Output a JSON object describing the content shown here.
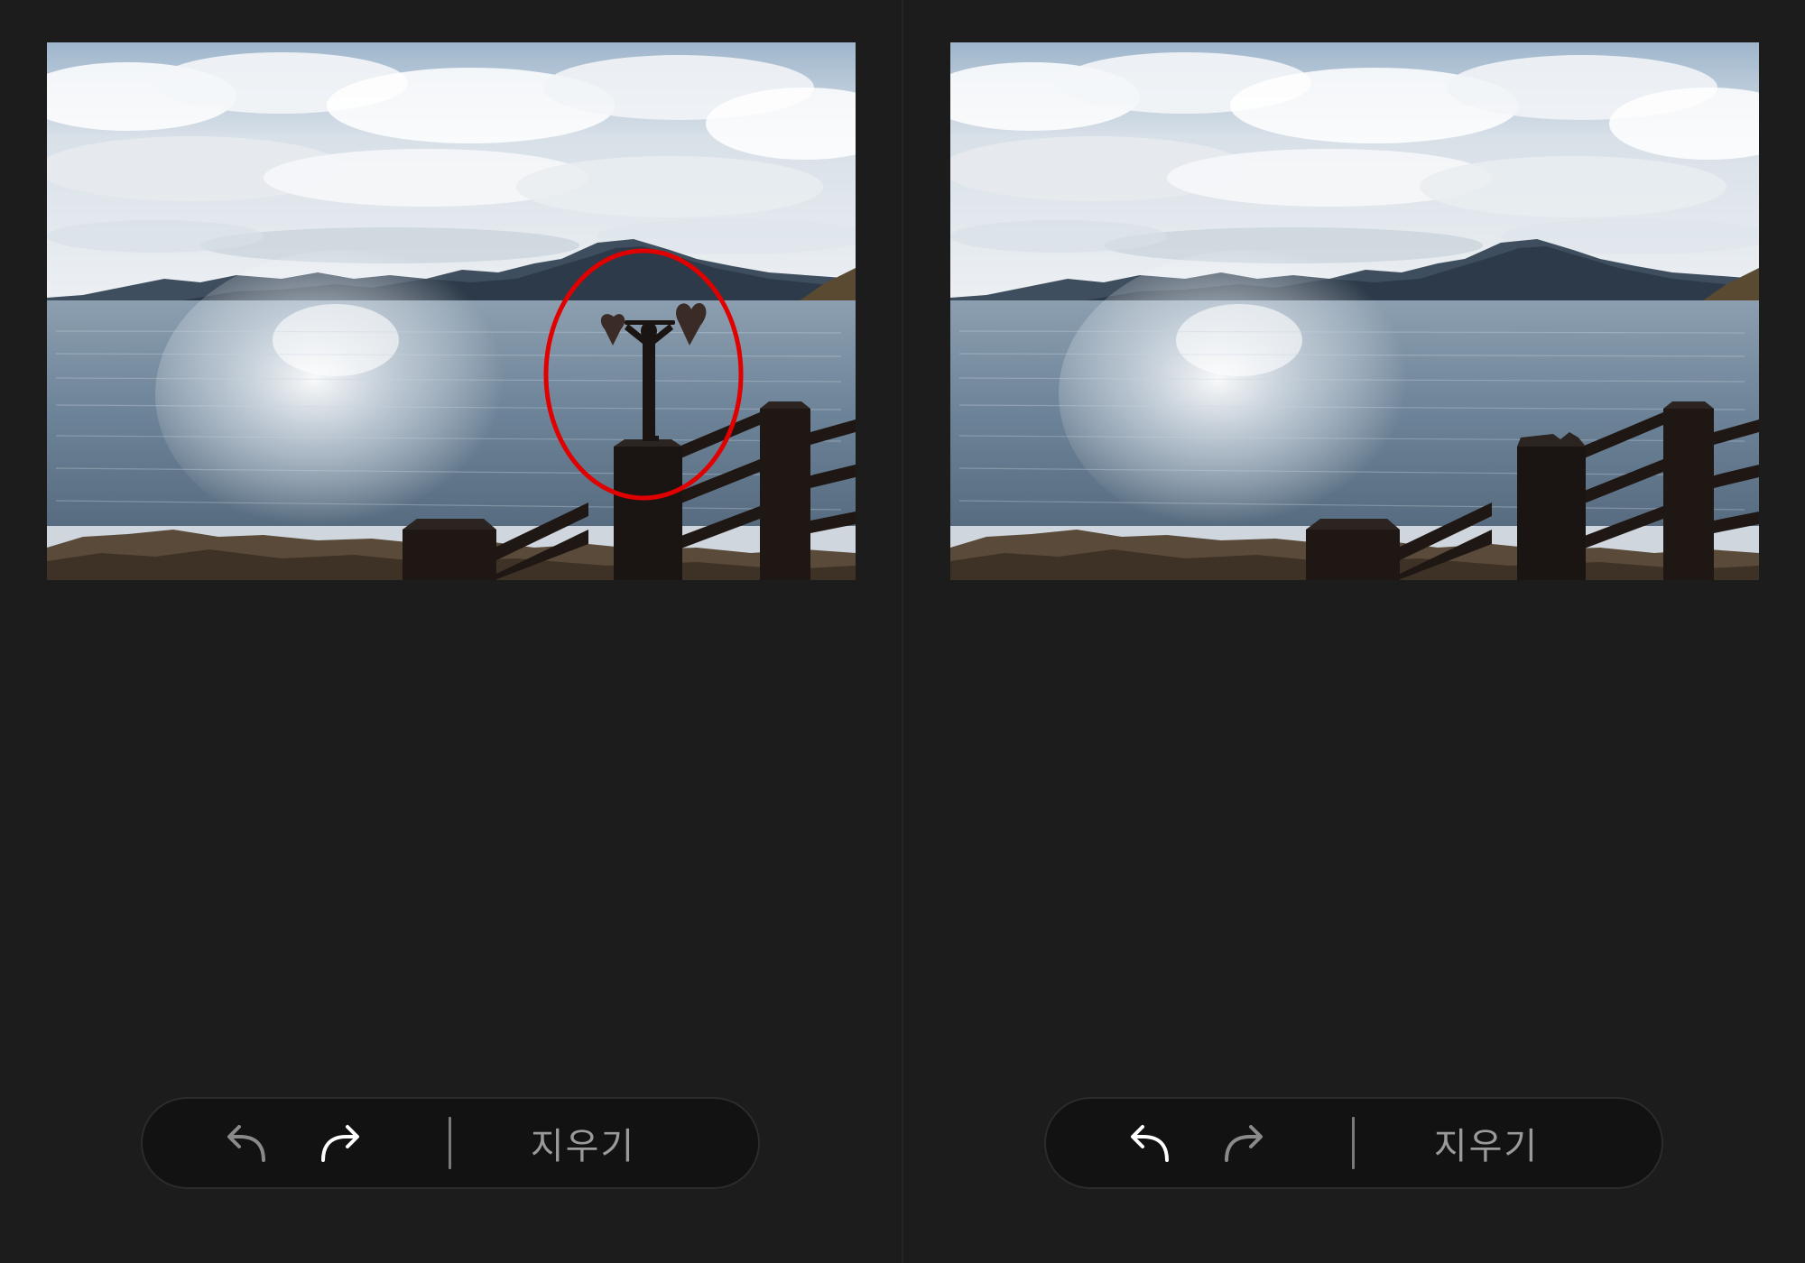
{
  "panels": [
    {
      "id": "before",
      "toolbar": {
        "undo": {
          "icon": "undo-arrow-icon",
          "enabled": false,
          "color": "#8a8a8a"
        },
        "redo": {
          "icon": "redo-arrow-icon",
          "enabled": true,
          "color": "#ffffff"
        },
        "erase_label": "지우기",
        "erase_color": "#9a9a9a"
      },
      "selection_marker": {
        "shape": "ellipse",
        "color": "#e00000"
      }
    },
    {
      "id": "after",
      "toolbar": {
        "undo": {
          "icon": "undo-arrow-icon",
          "enabled": true,
          "color": "#ffffff"
        },
        "redo": {
          "icon": "redo-arrow-icon",
          "enabled": false,
          "color": "#8a8a8a"
        },
        "erase_label": "지우기",
        "erase_color": "#9a9a9a"
      }
    }
  ],
  "colors": {
    "background": "#1c1c1c",
    "toolbar_bg": "#121212",
    "separator": "#7a7a7a"
  }
}
